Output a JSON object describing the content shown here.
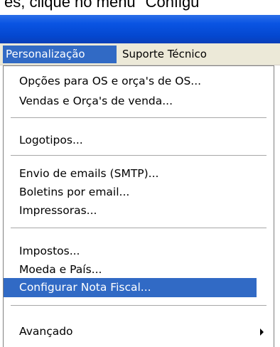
{
  "document": {
    "caption_fragment": "es, clique no menu \"Configu"
  },
  "menubar": {
    "items": [
      "Personalização",
      "Suporte Técnico"
    ]
  },
  "dropdown": {
    "items": [
      "Opções para OS e orça's de OS...",
      "Vendas e Orça's de venda...",
      "Logotipos...",
      "Envio de emails (SMTP)...",
      "Boletins por email...",
      "Impressoras...",
      "Impostos...",
      "Moeda e País...",
      "Configurar Nota Fiscal...",
      "Avançado"
    ],
    "highlighted_item": "Configurar Nota Fiscal...",
    "submenu_icon": "triangle-right-icon"
  },
  "colors": {
    "titlebar": "#0a54e3",
    "selection": "#316ac5",
    "menu_background": "#ece9d8"
  }
}
